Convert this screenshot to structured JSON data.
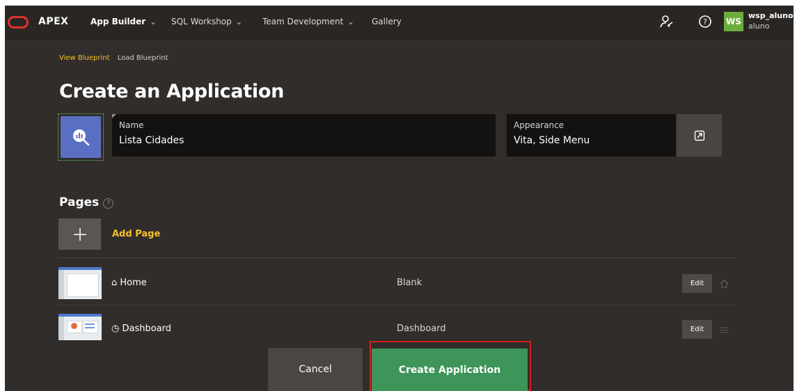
{
  "header": {
    "brand": "APEX",
    "nav": [
      {
        "label": "App Builder",
        "dropdown": true
      },
      {
        "label": "SQL Workshop",
        "dropdown": true
      },
      {
        "label": "Team Development",
        "dropdown": true
      },
      {
        "label": "Gallery",
        "dropdown": false
      }
    ],
    "user": {
      "initials": "WS",
      "name": "wsp_aluno",
      "workspace": "aluno"
    },
    "icons": [
      "oracle-logo",
      "user-settings-icon",
      "help-icon"
    ]
  },
  "blueprint_links": {
    "view": "View Blueprint",
    "load": "Load Blueprint"
  },
  "page_title": "Create an Application",
  "app_icon": "app-icon-chart-search",
  "fields": {
    "name": {
      "label": "Name",
      "value": "Lista Cidades"
    },
    "appearance": {
      "label": "Appearance",
      "value": "Vita, Side Menu"
    }
  },
  "pages": {
    "heading": "Pages",
    "add_label": "Add Page",
    "rows": [
      {
        "name": "Home",
        "type": "Blank",
        "edit": "Edit",
        "icon": "home-icon"
      },
      {
        "name": "Dashboard",
        "type": "Dashboard",
        "edit": "Edit",
        "icon": "dashboard-icon"
      }
    ]
  },
  "footer": {
    "cancel": "Cancel",
    "create": "Create Application"
  },
  "colors": {
    "background": "#312d2a",
    "accent": "#f5c02b",
    "create": "#3e955a",
    "highlight": "#d21f1f"
  }
}
